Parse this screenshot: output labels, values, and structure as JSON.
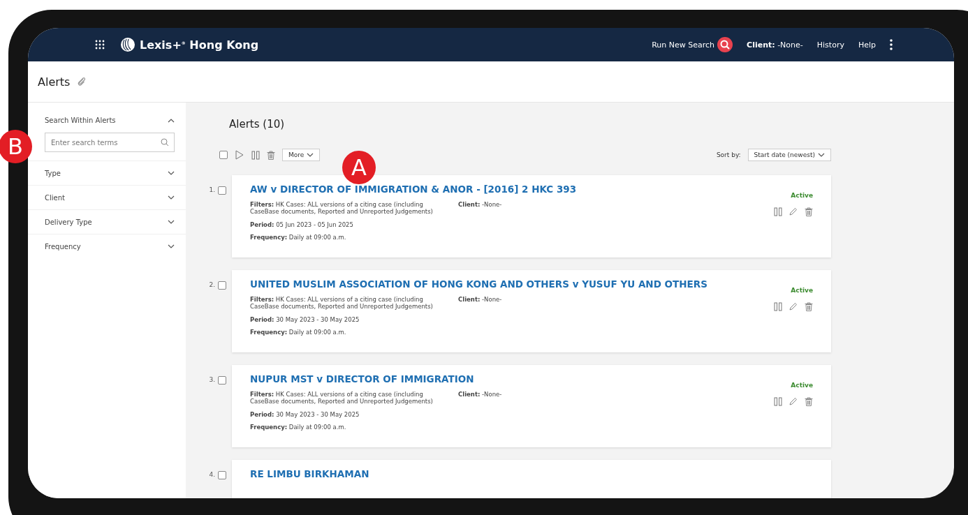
{
  "header": {
    "brand": "Lexis+",
    "brand_mark": "®",
    "region": "Hong Kong",
    "run_search": "Run New Search",
    "client_label": "Client:",
    "client_value": "-None-",
    "links": [
      "History",
      "Help"
    ]
  },
  "page_title": "Alerts",
  "sidebar": {
    "search_section": {
      "label": "Search Within Alerts",
      "expanded": true,
      "placeholder": "Enter search terms"
    },
    "filters": [
      {
        "label": "Type",
        "expanded": false
      },
      {
        "label": "Client",
        "expanded": false
      },
      {
        "label": "Delivery Type",
        "expanded": false
      },
      {
        "label": "Frequency",
        "expanded": false
      }
    ]
  },
  "list_title": "Alerts (10)",
  "toolbar": {
    "select_all_checked": false,
    "more": "More",
    "sort_label": "Sort by:",
    "sort_value": "Start date (newest)"
  },
  "alerts": [
    {
      "number": "1.",
      "checked": false,
      "title": "AW v DIRECTOR OF IMMIGRATION & ANOR - [2016] 2 HKC 393",
      "filters_label": "Filters:",
      "filters": "HK Cases: ALL versions of a citing case (including CaseBase documents, Reported and Unreported Judgements)",
      "client_label": "Client:",
      "client": "-None-",
      "period_label": "Period:",
      "period": "05 Jun 2023 - 05 Jun 2025",
      "frequency_label": "Frequency:",
      "frequency": "Daily at 09:00 a.m.",
      "status": "Active"
    },
    {
      "number": "2.",
      "checked": false,
      "title": "UNITED MUSLIM ASSOCIATION OF HONG KONG AND OTHERS v YUSUF YU AND OTHERS",
      "filters_label": "Filters:",
      "filters": "HK Cases: ALL versions of a citing case (including CaseBase documents, Reported and Unreported Judgements)",
      "client_label": "Client:",
      "client": "-None-",
      "period_label": "Period:",
      "period": "30 May 2023 - 30 May 2025",
      "frequency_label": "Frequency:",
      "frequency": "Daily at 09:00 a.m.",
      "status": "Active"
    },
    {
      "number": "3.",
      "checked": false,
      "title": "NUPUR MST v DIRECTOR OF IMMIGRATION",
      "filters_label": "Filters:",
      "filters": "HK Cases: ALL versions of a citing case (including CaseBase documents, Reported and Unreported Judgements)",
      "client_label": "Client:",
      "client": "-None-",
      "period_label": "Period:",
      "period": "30 May 2023 - 30 May 2025",
      "frequency_label": "Frequency:",
      "frequency": "Daily at 09:00 a.m.",
      "status": "Active"
    },
    {
      "number": "4.",
      "checked": false,
      "title": "RE LIMBU BIRKHAMAN"
    }
  ],
  "callouts": [
    {
      "kind": "toolbar",
      "label": "A"
    },
    {
      "kind": "sidebar",
      "label": "B"
    }
  ]
}
